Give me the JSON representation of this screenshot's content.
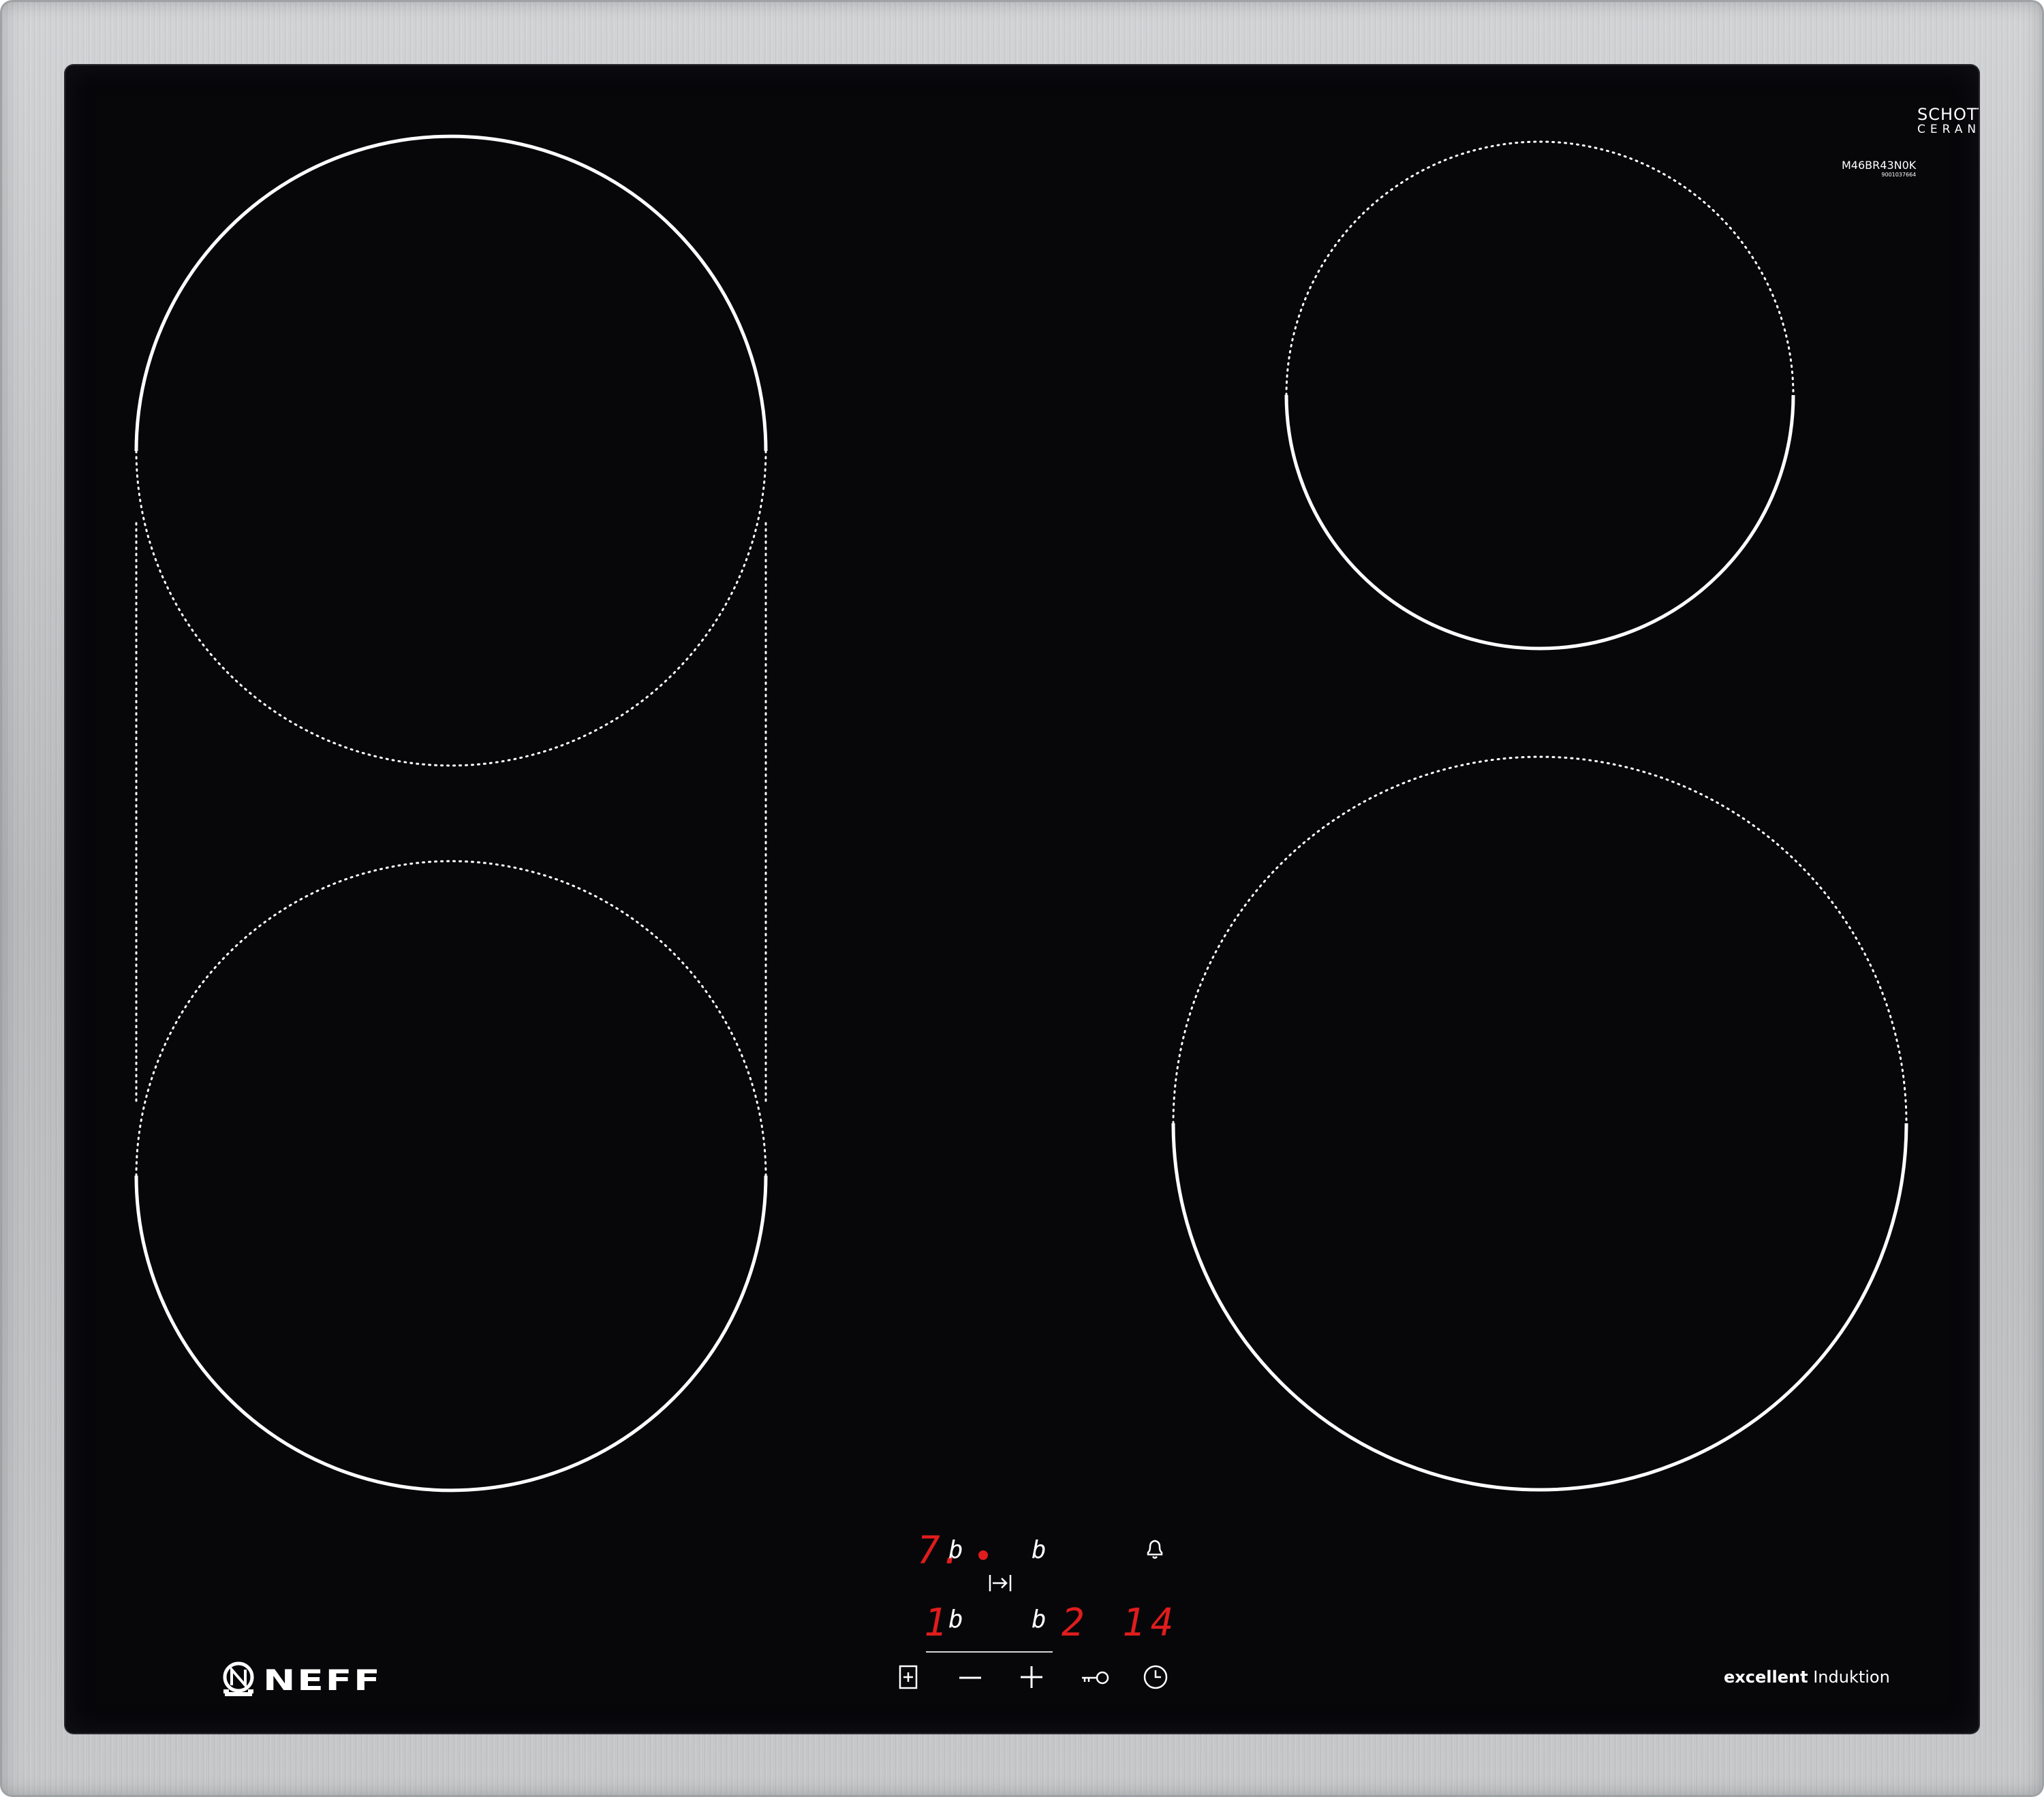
{
  "brand": {
    "logo_text": "NEFF",
    "glass_maker_line1": "SCHOTT",
    "glass_maker_line2": "CERAN®",
    "model_number": "M46BR43N0K",
    "serial_number": "9001037664",
    "tagline_bold": "excellent",
    "tagline_regular": "Induktion"
  },
  "colors": {
    "glass": "#07070a",
    "frame": "#c6c8ca",
    "zone_marking": "#ffffff",
    "display_red": "#e01c1c"
  },
  "zones": [
    {
      "name": "flex-zone-front-left",
      "combinable": true
    },
    {
      "name": "flex-zone-rear-left",
      "combinable": true
    },
    {
      "name": "rear-right-zone"
    },
    {
      "name": "front-right-zone"
    }
  ],
  "control_panel": {
    "display_rear_left_level": "7.",
    "display_rear_left_residual": "b",
    "display_rear_right_residual": "b",
    "display_front_left_level": "1",
    "display_front_left_residual": "b",
    "display_front_right_residual": "b",
    "display_timer_digit1": "2",
    "display_timer_digits2": "14",
    "active_indicator": "on",
    "icons": {
      "timer_alarm": "bell-icon",
      "zone_selector": "zone-select-icon",
      "minus": "minus-icon",
      "plus": "plus-icon",
      "child_lock": "key-icon",
      "timer": "clock-icon",
      "flex_toggle": "flex-arrow-icon"
    }
  }
}
